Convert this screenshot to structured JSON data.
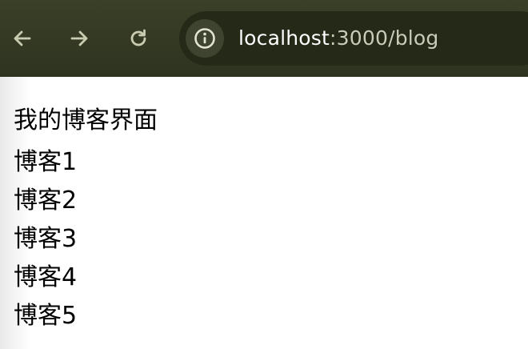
{
  "browser": {
    "back_icon": "arrow-left-icon",
    "forward_icon": "arrow-right-icon",
    "reload_icon": "reload-icon",
    "info_icon": "info-icon",
    "url_host": "localhost",
    "url_rest": ":3000/blog",
    "colors": {
      "toolbar": "#3b4028",
      "omnibox": "#252917",
      "icon": "#c9ccb0",
      "url_host_text": "#ffffff",
      "url_rest_text": "#c9ccb8"
    }
  },
  "page": {
    "title": "我的博客界面",
    "blogs": [
      {
        "label": "博客1"
      },
      {
        "label": "博客2"
      },
      {
        "label": "博客3"
      },
      {
        "label": "博客4"
      },
      {
        "label": "博客5"
      }
    ]
  }
}
